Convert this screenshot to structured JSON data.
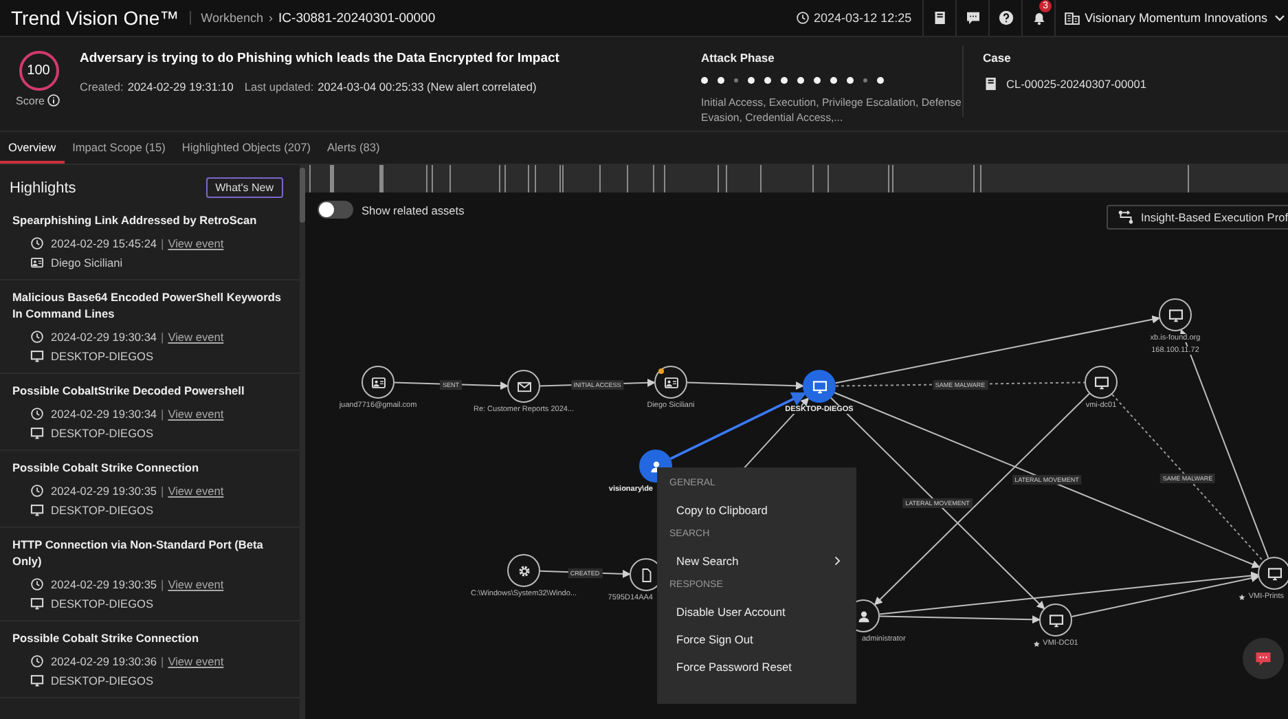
{
  "header": {
    "brand": "Trend Vision One™",
    "breadcrumb": [
      "Workbench",
      "IC-30881-20240301-00000"
    ],
    "separator": "›",
    "datetime": "2024-03-12 12:25",
    "notifications": "3",
    "org": "Visionary Momentum Innovations"
  },
  "alert": {
    "score": "100",
    "score_label": "Score",
    "title": "Adversary is trying to do Phishing which leads the Data Encrypted for Impact",
    "created_label": "Created:",
    "created": "2024-02-29 19:31:10",
    "updated_label": "Last updated:",
    "updated": "2024-03-04 00:25:33 (New alert correlated)"
  },
  "attack_phase": {
    "title": "Attack Phase",
    "phases": [
      {
        "on": true
      },
      {
        "on": true
      },
      {
        "on": false
      },
      {
        "on": true
      },
      {
        "on": true
      },
      {
        "on": true
      },
      {
        "on": true
      },
      {
        "on": true
      },
      {
        "on": true
      },
      {
        "on": true
      },
      {
        "on": false
      },
      {
        "on": true
      }
    ],
    "summary": "Initial Access, Execution, Privilege Escalation, Defense Evasion, Credential Access,..."
  },
  "case": {
    "title": "Case",
    "id": "CL-00025-20240307-00001"
  },
  "tabs": [
    {
      "label": "Overview",
      "selected": true
    },
    {
      "label": "Impact Scope (15)",
      "selected": false
    },
    {
      "label": "Highlighted Objects (207)",
      "selected": false
    },
    {
      "label": "Alerts (83)",
      "selected": false
    }
  ],
  "highlights": {
    "title": "Highlights",
    "button": "What's New",
    "items": [
      {
        "title": "Spearphishing Link Addressed by RetroScan",
        "time": "2024-02-29 15:45:24",
        "separator": "|",
        "link": "View event",
        "kind": "user",
        "entity": "Diego Siciliani"
      },
      {
        "title": "Malicious Base64 Encoded PowerShell Keywords In Command Lines",
        "time": "2024-02-29 19:30:34",
        "separator": "|",
        "link": "View event",
        "kind": "host",
        "entity": "DESKTOP-DIEGOS"
      },
      {
        "title": "Possible CobaltStrike Decoded Powershell",
        "time": "2024-02-29 19:30:34",
        "separator": "|",
        "link": "View event",
        "kind": "host",
        "entity": "DESKTOP-DIEGOS"
      },
      {
        "title": "Possible Cobalt Strike Connection",
        "time": "2024-02-29 19:30:35",
        "separator": "|",
        "link": "View event",
        "kind": "host",
        "entity": "DESKTOP-DIEGOS"
      },
      {
        "title": "HTTP Connection via Non-Standard Port (Beta Only)",
        "time": "2024-02-29 19:30:35",
        "separator": "|",
        "link": "View event",
        "kind": "host",
        "entity": "DESKTOP-DIEGOS"
      },
      {
        "title": "Possible Cobalt Strike Connection",
        "time": "2024-02-29 19:30:36",
        "separator": "|",
        "link": "View event",
        "kind": "host",
        "entity": "DESKTOP-DIEGOS"
      }
    ]
  },
  "graph": {
    "toggle": {
      "label": "Show related assets",
      "on": false
    },
    "profile_button": "Insight-Based Execution Prof",
    "nodes": [
      {
        "kind": "card",
        "label": "juand7716@gmail.com",
        "selected": false,
        "starred": false,
        "alert": false
      },
      {
        "kind": "mail",
        "label": "Re: Customer Reports 2024...",
        "selected": false,
        "starred": false,
        "alert": false
      },
      {
        "kind": "card",
        "label": "Diego Siciliani",
        "selected": false,
        "starred": false,
        "alert": true
      },
      {
        "kind": "monitor",
        "label": "DESKTOP-DIEGOS",
        "selected": true,
        "starred": false,
        "alert": false
      },
      {
        "kind": "monitor",
        "label": "xb.is-found.org",
        "sublabel": "168.100.11.72",
        "selected": false,
        "starred": false,
        "alert": false
      },
      {
        "kind": "monitor",
        "label": "vmi-dc01",
        "selected": false,
        "starred": false,
        "alert": false
      },
      {
        "kind": "user",
        "label": "visionary\\de",
        "selected": true,
        "starred": false,
        "alert": false
      },
      {
        "kind": "gear",
        "label": "C:\\Windows\\System32\\Windo...",
        "selected": false,
        "starred": false,
        "alert": false
      },
      {
        "kind": "file",
        "label": "7595D14AA4",
        "selected": false,
        "starred": false,
        "alert": false
      },
      {
        "kind": "user",
        "label": "administrator",
        "selected": false,
        "starred": false,
        "alert": false
      },
      {
        "kind": "monitor",
        "label": "VMI-DC01",
        "selected": false,
        "starred": true,
        "alert": false
      },
      {
        "kind": "monitor",
        "label": "VMI-Prints",
        "selected": false,
        "starred": true,
        "alert": false
      }
    ],
    "edges": [
      {
        "label": "SENT",
        "dashed": false,
        "highlighted": false
      },
      {
        "label": "INITIAL ACCESS",
        "dashed": false,
        "highlighted": false
      },
      {
        "dashed": false,
        "highlighted": false
      },
      {
        "dashed": false,
        "highlighted": true
      },
      {
        "dashed": false,
        "highlighted": false
      },
      {
        "label": "SAME MALWARE",
        "dashed": true,
        "highlighted": false
      },
      {
        "label": "LATERAL MOVEMENT",
        "dashed": false,
        "highlighted": false
      },
      {
        "label": "LATERAL MOVEMENT",
        "dashed": false,
        "highlighted": false
      },
      {
        "dashed": false,
        "highlighted": false
      },
      {
        "label": "SAME MALWARE",
        "dashed": true,
        "highlighted": false
      },
      {
        "dashed": false,
        "highlighted": false
      },
      {
        "dashed": false,
        "highlighted": false
      },
      {
        "dashed": false,
        "highlighted": false
      },
      {
        "dashed": false,
        "highlighted": false
      },
      {
        "label": "CREATED",
        "dashed": false,
        "highlighted": false
      },
      {
        "dashed": false,
        "highlighted": false
      }
    ],
    "context_menu": [
      {
        "heading": "GENERAL",
        "items": [
          {
            "label": "Copy to Clipboard",
            "submenu": false
          }
        ]
      },
      {
        "heading": "SEARCH",
        "items": [
          {
            "label": "New Search",
            "submenu": true
          }
        ]
      },
      {
        "heading": "RESPONSE",
        "items": [
          {
            "label": "Disable User Account",
            "submenu": false
          },
          {
            "label": "Force Sign Out",
            "submenu": false
          },
          {
            "label": "Force Password Reset",
            "submenu": false
          }
        ]
      }
    ]
  }
}
